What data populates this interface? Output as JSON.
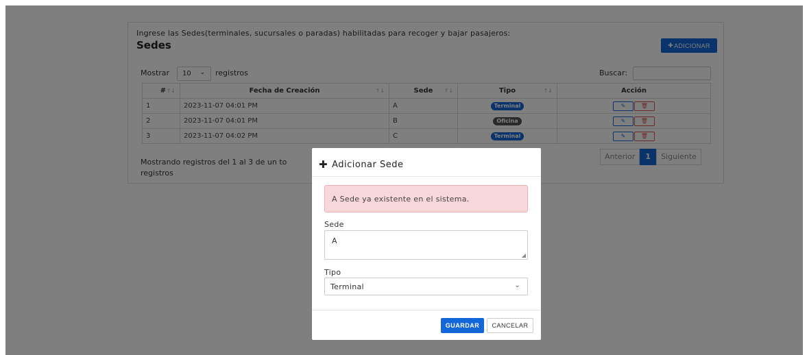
{
  "card": {
    "description": "Ingrese las Sedes(terminales, sucursales o paradas) habilitadas para recoger y bajar pasajeros:",
    "title": "Sedes",
    "add_button": "ADICIONAR"
  },
  "controls": {
    "show_label": "Mostrar",
    "page_size": "10",
    "records_label": "registros",
    "search_label": "Buscar:",
    "search_value": ""
  },
  "table": {
    "columns": [
      "#",
      "Fecha de Creación",
      "Sede",
      "Tipo",
      "Acción"
    ],
    "rows": [
      {
        "num": "1",
        "date": "2023-11-07 04:01 PM",
        "sede": "A",
        "tipo": "Terminal"
      },
      {
        "num": "2",
        "date": "2023-11-07 04:01 PM",
        "sede": "B",
        "tipo": "Oficina"
      },
      {
        "num": "3",
        "date": "2023-11-07 04:02 PM",
        "sede": "C",
        "tipo": "Terminal"
      }
    ]
  },
  "footer": {
    "info": "Mostrando registros del 1 al 3 de un to",
    "info_line2": "registros"
  },
  "pagination": {
    "prev": "Anterior",
    "current": "1",
    "next": "Siguiente"
  },
  "modal": {
    "title": "Adicionar Sede",
    "alert": "A Sede ya existente en el sistema.",
    "sede_label": "Sede",
    "sede_value": "A",
    "tipo_label": "Tipo",
    "tipo_value": "Terminal",
    "save_button": "GUARDAR",
    "cancel_button": "CANCELAR"
  },
  "colors": {
    "primary": "#1467d8",
    "badge_terminal": "#1467d8",
    "badge_oficina": "#555555",
    "danger": "#d9534f",
    "alert_bg": "#f8d7da"
  }
}
